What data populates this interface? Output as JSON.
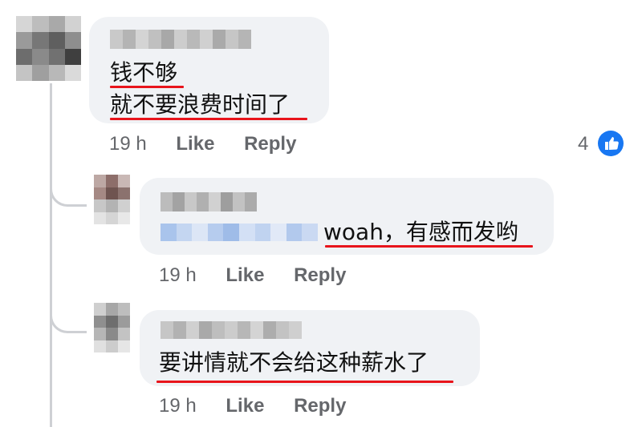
{
  "comments": [
    {
      "text_lines": [
        "钱不够",
        "就不要浪费时间了"
      ],
      "time": "19 h",
      "like_label": "Like",
      "reply_label": "Reply",
      "reaction_count": "4",
      "reaction_icon": "thumbs-up-icon"
    },
    {
      "text": "woah，有感而发哟",
      "time": "19 h",
      "like_label": "Like",
      "reply_label": "Reply"
    },
    {
      "text": "要讲情就不会给这种薪水了",
      "time": "19 h",
      "like_label": "Like",
      "reply_label": "Reply"
    }
  ],
  "colors": {
    "bubble": "#f0f2f5",
    "underline": "#e8141b",
    "meta_text": "#65676b",
    "like_badge": "#1877f2"
  }
}
